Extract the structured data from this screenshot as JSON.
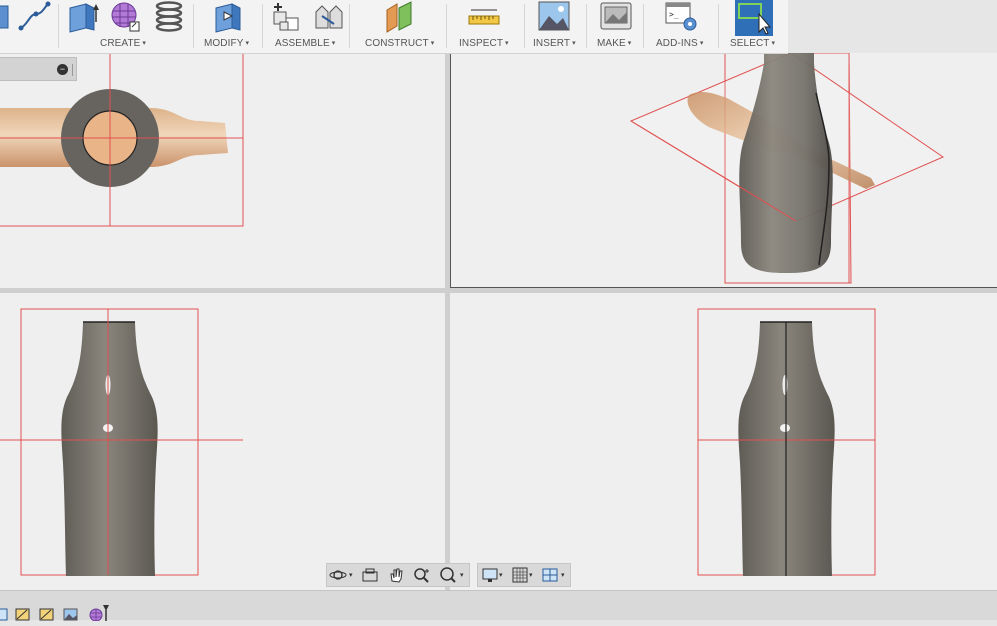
{
  "toolbar": {
    "groups": [
      {
        "label": "CREATE"
      },
      {
        "label": "MODIFY"
      },
      {
        "label": "ASSEMBLE"
      },
      {
        "label": "CONSTRUCT"
      },
      {
        "label": "INSPECT"
      },
      {
        "label": "INSERT"
      },
      {
        "label": "MAKE"
      },
      {
        "label": "ADD-INS"
      },
      {
        "label": "SELECT"
      }
    ],
    "caret": "▾"
  },
  "browser": {
    "minimize_glyph": "−"
  },
  "viewports": [
    {
      "name": "top-view"
    },
    {
      "name": "perspective-view"
    },
    {
      "name": "front-view"
    },
    {
      "name": "right-view"
    }
  ],
  "navbar": {
    "icons": [
      "orbit-icon",
      "look-at-icon",
      "pan-icon",
      "zoom-icon",
      "zoom-window-icon",
      "display-settings-icon",
      "grid-settings-icon",
      "viewports-icon"
    ]
  },
  "timeline": {
    "items": [
      "sketch-icon",
      "canvas-icon",
      "canvas-icon",
      "image-icon",
      "form-icon"
    ]
  },
  "colors": {
    "accent": "#2f6fb7",
    "plane_line": "#e05050",
    "bottle_body": "#7b776e"
  }
}
